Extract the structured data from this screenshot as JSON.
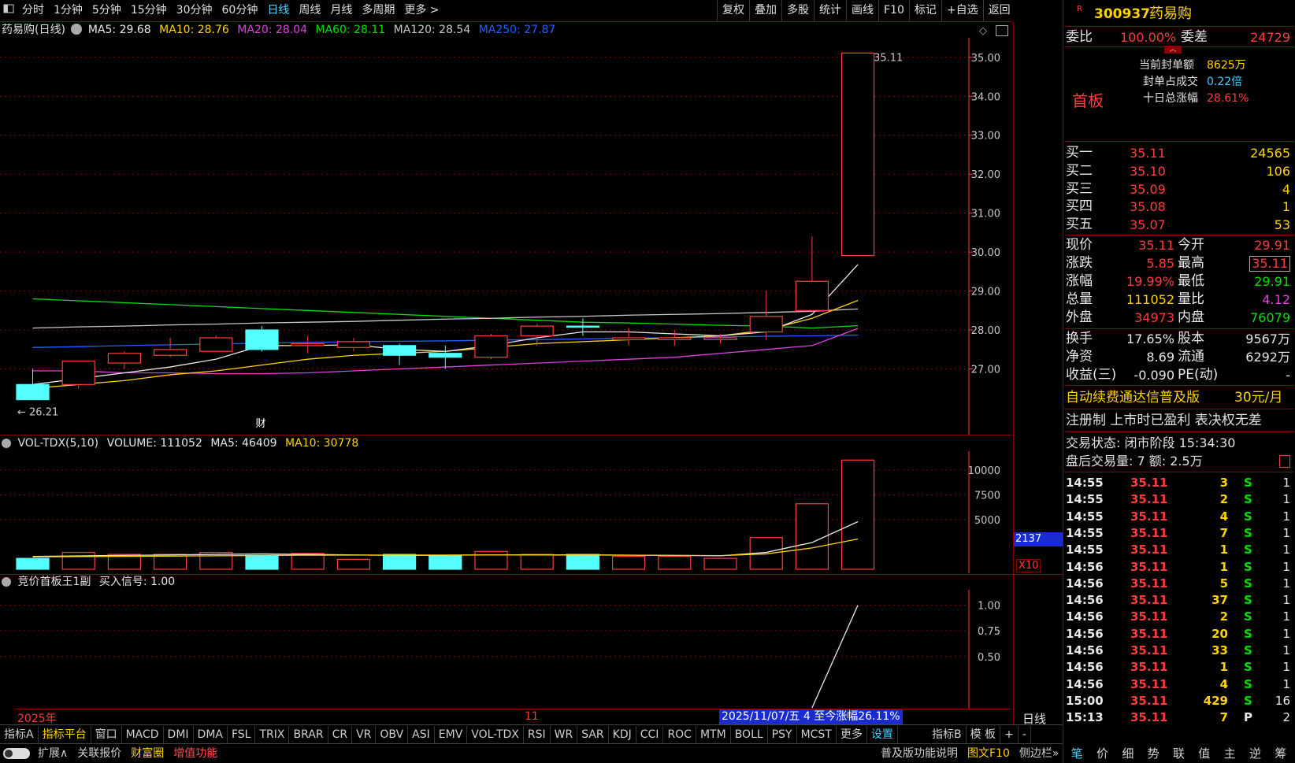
{
  "toolbar": {
    "left_items": [
      "分时",
      "1分钟",
      "5分钟",
      "15分钟",
      "30分钟",
      "60分钟",
      "日线",
      "周线",
      "月线",
      "多周期",
      "更多 >"
    ],
    "active": "日线",
    "right_items": [
      "复权",
      "叠加",
      "多股",
      "统计",
      "画线",
      "F10",
      "标记",
      "+自选",
      "返回"
    ]
  },
  "chart_header": {
    "title": "药易购(日线)",
    "ma5": "MA5: 29.68",
    "ma10": "MA10: 28.76",
    "ma20": "MA20: 28.04",
    "ma60": "MA60: 28.11",
    "ma120": "MA120: 28.54",
    "ma250": "MA250: 27.87"
  },
  "colors": {
    "up": "#ff3b3b",
    "down": "#54ffff",
    "ma5": "#e8e8e8",
    "ma10": "#ffd200",
    "ma20": "#e040e0",
    "ma60": "#00e000",
    "ma120": "#c8c8c8",
    "ma250": "#2060ff",
    "grid": "#8a0000"
  },
  "chart_data": [
    {
      "type": "candlestick",
      "title": "药易购(日线)",
      "ylim": [
        26.0,
        35.4
      ],
      "yticks": [
        "35.00",
        "34.00",
        "33.00",
        "32.00",
        "31.00",
        "30.00",
        "29.00",
        "28.00",
        "27.00"
      ],
      "ytick_values": [
        35,
        34,
        33,
        32,
        31,
        30,
        29,
        28,
        27
      ],
      "candles": [
        {
          "o": 26.21,
          "c": 26.6,
          "h": 27.0,
          "l": 26.21,
          "dir": "down"
        },
        {
          "o": 26.6,
          "c": 27.2,
          "h": 27.2,
          "l": 26.5,
          "dir": "up"
        },
        {
          "o": 27.15,
          "c": 27.4,
          "h": 27.45,
          "l": 27.0,
          "dir": "up"
        },
        {
          "o": 27.35,
          "c": 27.5,
          "h": 27.8,
          "l": 27.3,
          "dir": "up"
        },
        {
          "o": 27.45,
          "c": 27.8,
          "h": 27.85,
          "l": 27.45,
          "dir": "up"
        },
        {
          "o": 28.0,
          "c": 27.5,
          "h": 28.1,
          "l": 27.45,
          "dir": "down"
        },
        {
          "o": 27.6,
          "c": 27.65,
          "h": 27.85,
          "l": 27.4,
          "dir": "up"
        },
        {
          "o": 27.55,
          "c": 27.7,
          "h": 27.8,
          "l": 27.45,
          "dir": "up"
        },
        {
          "o": 27.6,
          "c": 27.35,
          "h": 27.65,
          "l": 27.1,
          "dir": "down"
        },
        {
          "o": 27.4,
          "c": 27.3,
          "h": 27.6,
          "l": 27.0,
          "dir": "down"
        },
        {
          "o": 27.3,
          "c": 27.85,
          "h": 27.9,
          "l": 27.25,
          "dir": "up"
        },
        {
          "o": 27.85,
          "c": 28.1,
          "h": 28.15,
          "l": 27.6,
          "dir": "up"
        },
        {
          "o": 28.1,
          "c": 28.1,
          "h": 28.3,
          "l": 27.85,
          "dir": "down"
        },
        {
          "o": 27.75,
          "c": 27.8,
          "h": 28.05,
          "l": 27.6,
          "dir": "up"
        },
        {
          "o": 27.75,
          "c": 27.8,
          "h": 28.0,
          "l": 27.6,
          "dir": "up"
        },
        {
          "o": 27.75,
          "c": 27.8,
          "h": 27.9,
          "l": 27.65,
          "dir": "up"
        },
        {
          "o": 27.95,
          "c": 28.35,
          "h": 29.0,
          "l": 27.75,
          "dir": "up"
        },
        {
          "o": 28.5,
          "c": 29.25,
          "h": 30.4,
          "l": 28.45,
          "dir": "up"
        },
        {
          "o": 29.91,
          "c": 35.11,
          "h": 35.11,
          "l": 29.91,
          "dir": "up"
        }
      ],
      "annotations": {
        "high": "35.11",
        "low": "26.21",
        "marker": "财"
      },
      "ma_lines": {
        "ma5": [
          26.6,
          26.75,
          26.9,
          27.05,
          27.25,
          27.6,
          27.6,
          27.62,
          27.5,
          27.45,
          27.6,
          27.8,
          27.95,
          27.95,
          27.9,
          27.85,
          27.95,
          28.4,
          29.68
        ],
        "ma10": [
          26.5,
          26.6,
          26.7,
          26.85,
          26.95,
          27.1,
          27.25,
          27.35,
          27.4,
          27.45,
          27.55,
          27.65,
          27.7,
          27.75,
          27.8,
          27.85,
          28.0,
          28.3,
          28.76
        ],
        "ma20": [
          26.95,
          26.95,
          26.9,
          26.9,
          26.88,
          26.88,
          26.9,
          26.95,
          27.0,
          27.05,
          27.1,
          27.15,
          27.2,
          27.25,
          27.3,
          27.4,
          27.5,
          27.6,
          28.04
        ],
        "ma60": [
          28.8,
          28.75,
          28.7,
          28.65,
          28.6,
          28.55,
          28.5,
          28.45,
          28.4,
          28.35,
          28.3,
          28.25,
          28.2,
          28.18,
          28.15,
          28.12,
          28.1,
          28.05,
          28.11
        ],
        "ma120": [
          28.05,
          28.08,
          28.1,
          28.13,
          28.15,
          28.18,
          28.2,
          28.22,
          28.25,
          28.28,
          28.3,
          28.33,
          28.35,
          28.38,
          28.4,
          28.42,
          28.45,
          28.48,
          28.54
        ],
        "ma250": [
          27.55,
          27.57,
          27.6,
          27.62,
          27.64,
          27.66,
          27.68,
          27.7,
          27.71,
          27.72,
          27.74,
          27.75,
          27.77,
          27.79,
          27.8,
          27.82,
          27.84,
          27.85,
          27.87
        ]
      }
    },
    {
      "type": "bar",
      "title": "VOL-TDX(5,10)",
      "ylim": [
        0,
        11500
      ],
      "yticks": [
        "10000",
        "7500",
        "5000"
      ],
      "ytick_values": [
        10000,
        7500,
        5000
      ],
      "values": [
        1100,
        1700,
        1500,
        1500,
        1700,
        1400,
        1600,
        1000,
        1500,
        1400,
        1800,
        1500,
        1500,
        1300,
        1300,
        1100,
        3200,
        6600,
        11000
      ],
      "ma5": [
        1300,
        1350,
        1400,
        1450,
        1500,
        1550,
        1500,
        1450,
        1400,
        1420,
        1450,
        1460,
        1460,
        1430,
        1400,
        1360,
        1700,
        2700,
        4800
      ],
      "ma10": [
        1250,
        1280,
        1300,
        1330,
        1360,
        1390,
        1420,
        1430,
        1440,
        1440,
        1450,
        1440,
        1430,
        1420,
        1400,
        1380,
        1550,
        2150,
        3050
      ]
    },
    {
      "type": "line",
      "title": "竞价首板王1副",
      "ylim": [
        0,
        1.15
      ],
      "yticks": [
        "1.00",
        "0.75",
        "0.50"
      ],
      "ytick_values": [
        1.0,
        0.75,
        0.5
      ],
      "x_index": [
        17,
        18
      ],
      "values": [
        0,
        1.0
      ]
    }
  ],
  "vol_header": {
    "name": "VOL-TDX(5,10)",
    "volume": "VOLUME: 111052",
    "ma5": "MA5: 46409",
    "ma10": "MA10: 30778",
    "cursor_value": "2137",
    "unit": "X10"
  },
  "ind_header": {
    "name": "竞价首板王1副",
    "signal": "买入信号: 1.00"
  },
  "time_axis": {
    "left": "2025年",
    "mid": "11",
    "highlight": "2025/11/07/五 4 至今涨幅26.11%",
    "right": "日线"
  },
  "indicator_tabs": [
    "指标A",
    "指标平台",
    "窗口",
    "MACD",
    "DMI",
    "DMA",
    "FSL",
    "TRIX",
    "BRAR",
    "CR",
    "VR",
    "OBV",
    "ASI",
    "EMV",
    "VOL-TDX",
    "RSI",
    "WR",
    "SAR",
    "KDJ",
    "CCI",
    "ROC",
    "MTM",
    "BOLL",
    "PSY",
    "MCST",
    "更多",
    "设置"
  ],
  "indicator_tabs_right": [
    "指标B",
    "模 板",
    "+",
    "-"
  ],
  "footer_left": [
    "扩展∧",
    "关联报价",
    "财富圈",
    "增值功能"
  ],
  "footer_right": [
    "普及版功能说明",
    "图文F10",
    "侧边栏»"
  ],
  "side_tabs": [
    "笔",
    "价",
    "细",
    "势",
    "联",
    "值",
    "主",
    "逆",
    "筹"
  ],
  "quote": {
    "code": "300937",
    "name": "药易购",
    "weibi_label": "委比",
    "weibi": "100.00%",
    "weicha_label": "委差",
    "weicha": "24729",
    "board_tag": "首板",
    "seal_amount_label": "当前封单额",
    "seal_amount": "8625万",
    "seal_ratio_label": "封单占成交",
    "seal_ratio": "0.22倍",
    "ten_day_label": "十日总涨幅",
    "ten_day": "28.61%",
    "bids": [
      {
        "label": "买一",
        "price": "35.11",
        "vol": "24565"
      },
      {
        "label": "买二",
        "price": "35.10",
        "vol": "106"
      },
      {
        "label": "买三",
        "price": "35.09",
        "vol": "4"
      },
      {
        "label": "买四",
        "price": "35.08",
        "vol": "1"
      },
      {
        "label": "买五",
        "price": "35.07",
        "vol": "53"
      }
    ],
    "stats": [
      {
        "l1": "现价",
        "v1": "35.11",
        "l2": "今开",
        "v2": "29.91"
      },
      {
        "l1": "涨跌",
        "v1": "5.85",
        "l2": "最高",
        "v2": "35.11"
      },
      {
        "l1": "涨幅",
        "v1": "19.99%",
        "l2": "最低",
        "v2": "29.91"
      },
      {
        "l1": "总量",
        "v1": "111052",
        "l2": "量比",
        "v2": "4.12"
      },
      {
        "l1": "外盘",
        "v1": "34973",
        "l2": "内盘",
        "v2": "76079"
      }
    ],
    "stats2": [
      {
        "l1": "换手",
        "v1": "17.65%",
        "l2": "股本",
        "v2": "9567万"
      },
      {
        "l1": "净资",
        "v1": "8.69",
        "l2": "流通",
        "v2": "6292万"
      },
      {
        "l1": "收益(三)",
        "v1": "-0.090",
        "l2": "PE(动)",
        "v2": "-"
      }
    ],
    "promo": "自动续费通达信普及版",
    "promo_price": "30元/月",
    "notice": "注册制 上市时已盈利 表决权无差",
    "trade_status": "交易状态: 闭市阶段 15:34:30",
    "after_hours": "盘后交易量: 7  额: 2.5万",
    "ticks": [
      {
        "t": "14:55",
        "p": "35.11",
        "v": "3",
        "s": "S",
        "n": "1"
      },
      {
        "t": "14:55",
        "p": "35.11",
        "v": "2",
        "s": "S",
        "n": "1"
      },
      {
        "t": "14:55",
        "p": "35.11",
        "v": "4",
        "s": "S",
        "n": "1"
      },
      {
        "t": "14:55",
        "p": "35.11",
        "v": "7",
        "s": "S",
        "n": "1"
      },
      {
        "t": "14:55",
        "p": "35.11",
        "v": "1",
        "s": "S",
        "n": "1"
      },
      {
        "t": "14:56",
        "p": "35.11",
        "v": "1",
        "s": "S",
        "n": "1"
      },
      {
        "t": "14:56",
        "p": "35.11",
        "v": "5",
        "s": "S",
        "n": "1"
      },
      {
        "t": "14:56",
        "p": "35.11",
        "v": "37",
        "s": "S",
        "n": "1"
      },
      {
        "t": "14:56",
        "p": "35.11",
        "v": "2",
        "s": "S",
        "n": "1"
      },
      {
        "t": "14:56",
        "p": "35.11",
        "v": "20",
        "s": "S",
        "n": "1"
      },
      {
        "t": "14:56",
        "p": "35.11",
        "v": "33",
        "s": "S",
        "n": "1"
      },
      {
        "t": "14:56",
        "p": "35.11",
        "v": "1",
        "s": "S",
        "n": "1"
      },
      {
        "t": "14:56",
        "p": "35.11",
        "v": "4",
        "s": "S",
        "n": "1"
      },
      {
        "t": "15:00",
        "p": "35.11",
        "v": "429",
        "s": "S",
        "n": "16"
      },
      {
        "t": "15:13",
        "p": "35.11",
        "v": "7",
        "s": "P",
        "n": "2"
      }
    ]
  }
}
